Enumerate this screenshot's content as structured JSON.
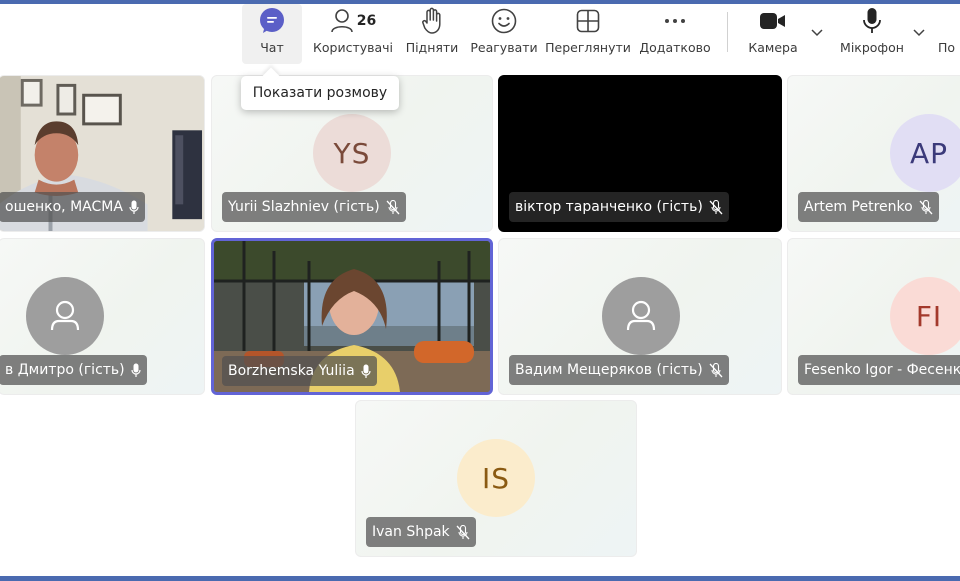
{
  "toolbar": {
    "items": [
      {
        "label": "Чат",
        "icon": "chat-icon"
      },
      {
        "label": "Користувачі",
        "icon": "people-icon",
        "count": "26"
      },
      {
        "label": "Підняти",
        "icon": "raise-hand-icon"
      },
      {
        "label": "Реагувати",
        "icon": "smile-icon"
      },
      {
        "label": "Переглянути",
        "icon": "grid-view-icon"
      },
      {
        "label": "Додатково",
        "icon": "more-icon"
      },
      {
        "label": "Камера",
        "icon": "camera-icon"
      },
      {
        "label": "Мікрофон",
        "icon": "microphone-icon"
      },
      {
        "label": "По",
        "icon": "share-icon"
      }
    ],
    "tooltip": "Показати розмову"
  },
  "colors": {
    "accent": "#6264d6",
    "chat_purple": "#5b5fc7",
    "frame_blue": "#4a6ab0",
    "ys_bg": "#ecdcd8",
    "ys_fg": "#7a4a3a",
    "ap_bg": "#e1def4",
    "ap_fg": "#3b3a7a",
    "fi_bg": "#fadbd6",
    "fi_fg": "#a3392c",
    "is_bg": "#fbeccc",
    "is_fg": "#8a5a12"
  },
  "participants": [
    {
      "name": "ошенко, MACMA",
      "type": "video",
      "mic": "on"
    },
    {
      "name": "Yurii Slazhniev (гість)",
      "initials": "YS",
      "mic": "muted"
    },
    {
      "name": "віктор таранченко (гість)",
      "type": "camera-off",
      "mic": "muted"
    },
    {
      "name": "Artem Petrenko",
      "initials": "AP",
      "mic": "muted"
    },
    {
      "name": "в Дмитро (гість)",
      "type": "generic",
      "mic": "on"
    },
    {
      "name": "Borzhemska Yuliia",
      "type": "video",
      "mic": "on",
      "speaking": true
    },
    {
      "name": "Вадим Мещеряков (гість)",
      "type": "generic",
      "mic": "muted"
    },
    {
      "name": "Fesenko Igor - Фесенк",
      "initials": "FI",
      "mic": "muted"
    },
    {
      "name": "Ivan Shpak",
      "initials": "IS",
      "mic": "muted"
    }
  ]
}
